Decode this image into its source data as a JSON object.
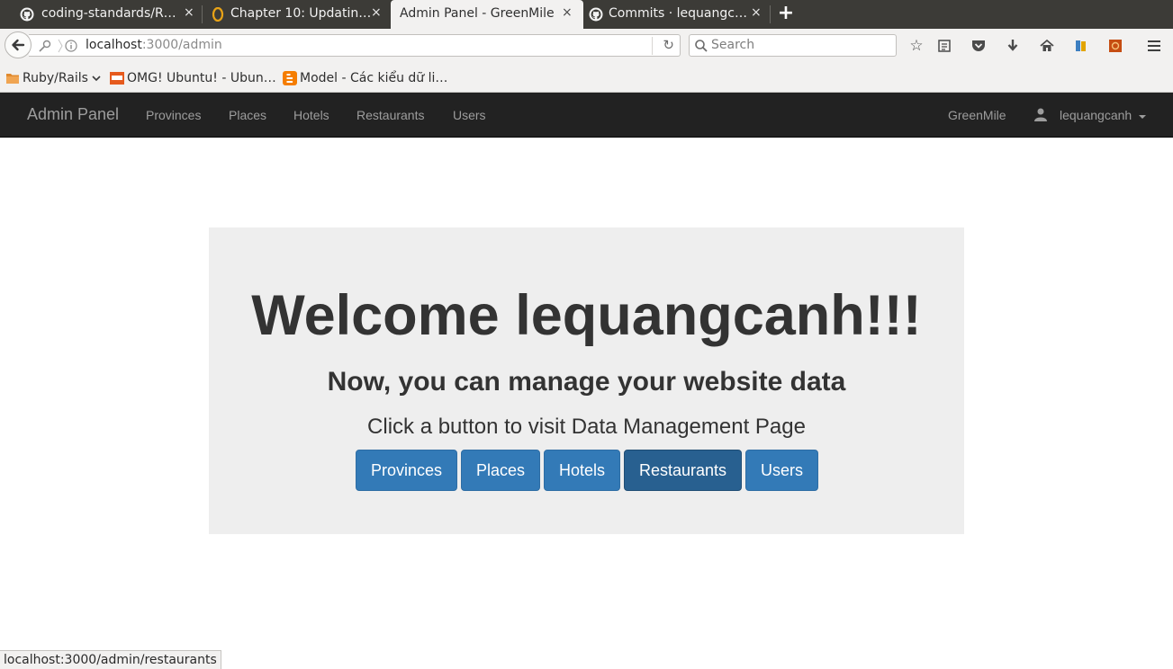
{
  "browser": {
    "tabs": [
      {
        "title": "coding-standards/R…",
        "icon": "github-icon",
        "active": false
      },
      {
        "title": "Chapter 10: Updatin…",
        "icon": "railstutorial-icon",
        "active": false
      },
      {
        "title": "Admin Panel - GreenMile",
        "icon": "",
        "active": true
      },
      {
        "title": "Commits · lequangc…",
        "icon": "github-icon",
        "active": false
      }
    ],
    "close_glyph": "×",
    "new_tab_glyph": "+",
    "url": {
      "host": "localhost",
      "path": ":3000/admin"
    },
    "search_placeholder": "Search",
    "bookmarks": [
      {
        "label": "Ruby/Rails",
        "icon": "folder-icon",
        "has_dropdown": true
      },
      {
        "label": "OMG! Ubuntu! - Ubun…",
        "icon": "omg-ubuntu-icon"
      },
      {
        "label": "Model - Các kiểu dữ li…",
        "icon": "blogger-icon"
      }
    ],
    "toolbar_icons": [
      "bookmark-star-icon",
      "reading-list-icon",
      "pocket-icon",
      "download-icon",
      "home-icon",
      "extension-icon",
      "ubuntu-extension-icon",
      "menu-icon"
    ]
  },
  "navbar": {
    "brand": "Admin Panel",
    "links": [
      "Provinces",
      "Places",
      "Hotels",
      "Restaurants",
      "Users"
    ],
    "site_name": "GreenMile",
    "user_name": "lequangcanh"
  },
  "jumbotron": {
    "title": "Welcome lequangcanh!!!",
    "subtitle": "Now, you can manage your website data",
    "prompt": "Click a button to visit Data Management Page",
    "buttons": [
      "Provinces",
      "Places",
      "Hotels",
      "Restaurants",
      "Users"
    ],
    "hovered_button": "Restaurants"
  },
  "status_bar": {
    "text": "localhost:3000/admin/restaurants"
  },
  "colors": {
    "navbar_bg": "#222222",
    "jumbotron_bg": "#eeeeee",
    "button_primary": "#337ab7",
    "button_hover": "#286090"
  }
}
